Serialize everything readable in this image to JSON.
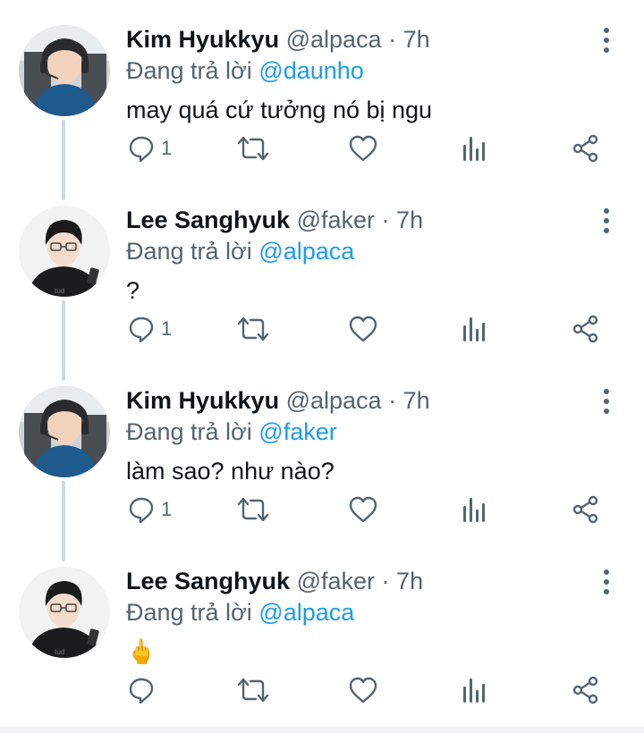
{
  "colors": {
    "accent": "#1d9bf0",
    "muted": "#536471",
    "text": "#0f1419",
    "thread": "#cfd9de"
  },
  "tweets": [
    {
      "name": "Kim Hyukkyu",
      "handle": "@alpaca",
      "dot": "·",
      "time": "7h",
      "reply_prefix": "Đang trả lời",
      "reply_to": "@daunho",
      "text": "may quá cứ tưởng nó bị ngu",
      "reply_count": "1",
      "avatar": "avatar-kim"
    },
    {
      "name": "Lee Sanghyuk",
      "handle": "@faker",
      "dot": "·",
      "time": "7h",
      "reply_prefix": "Đang trả lời",
      "reply_to": "@alpaca",
      "text": "?",
      "reply_count": "1",
      "avatar": "avatar-lee"
    },
    {
      "name": "Kim Hyukkyu",
      "handle": "@alpaca",
      "dot": "·",
      "time": "7h",
      "reply_prefix": "Đang trả lời",
      "reply_to": "@faker",
      "text": "làm sao? như nào?",
      "reply_count": "1",
      "avatar": "avatar-kim"
    },
    {
      "name": "Lee Sanghyuk",
      "handle": "@faker",
      "dot": "·",
      "time": "7h",
      "reply_prefix": "Đang trả lời",
      "reply_to": "@alpaca",
      "text": "🖕",
      "reply_count": "",
      "avatar": "avatar-lee"
    }
  ],
  "icons": [
    "reply-icon",
    "retweet-icon",
    "like-icon",
    "analytics-icon",
    "share-icon",
    "more-options-icon"
  ]
}
